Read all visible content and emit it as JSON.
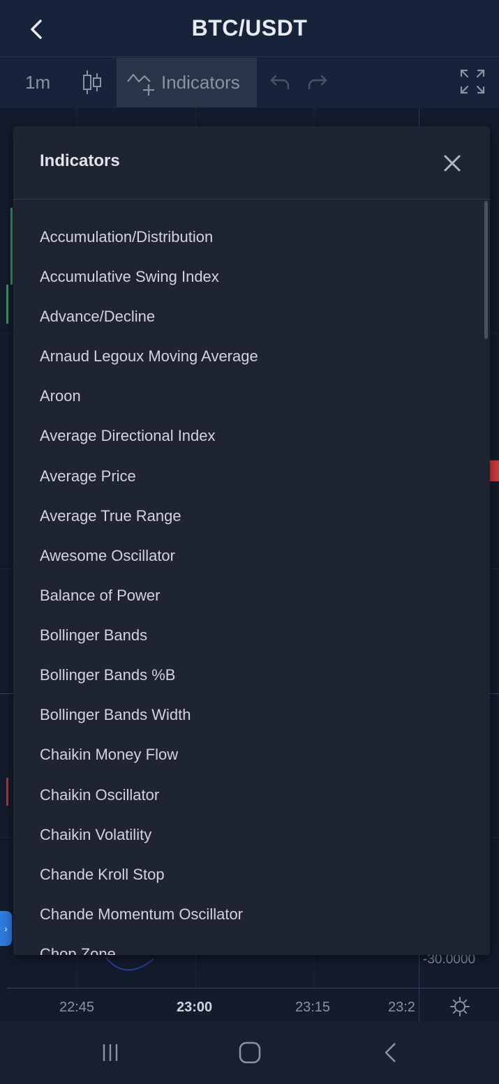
{
  "header": {
    "title": "BTC/USDT"
  },
  "toolbar": {
    "interval": "1m",
    "indicators_label": "Indicators"
  },
  "chart": {
    "time_labels": [
      "22:45",
      "23:00",
      "23:15",
      "23:2"
    ],
    "price_label": "-30.0000",
    "colors": {
      "up": "#26a65b",
      "down": "#c53030",
      "accent": "#2f7de1"
    }
  },
  "modal": {
    "title": "Indicators",
    "items": [
      "Accumulation/Distribution",
      "Accumulative Swing Index",
      "Advance/Decline",
      "Arnaud Legoux Moving Average",
      "Aroon",
      "Average Directional Index",
      "Average Price",
      "Average True Range",
      "Awesome Oscillator",
      "Balance of Power",
      "Bollinger Bands",
      "Bollinger Bands %B",
      "Bollinger Bands Width",
      "Chaikin Money Flow",
      "Chaikin Oscillator",
      "Chaikin Volatility",
      "Chande Kroll Stop",
      "Chande Momentum Oscillator",
      "Chop Zone"
    ]
  },
  "icons": {
    "back": "chevron-left-icon",
    "candles": "candlestick-icon",
    "indicators": "indicator-add-icon",
    "undo": "undo-icon",
    "redo": "redo-icon",
    "fullscreen": "fullscreen-icon",
    "close": "close-icon",
    "settings": "gear-icon",
    "nav_recent": "recent-apps-icon",
    "nav_home": "home-icon",
    "nav_back": "nav-back-icon"
  }
}
